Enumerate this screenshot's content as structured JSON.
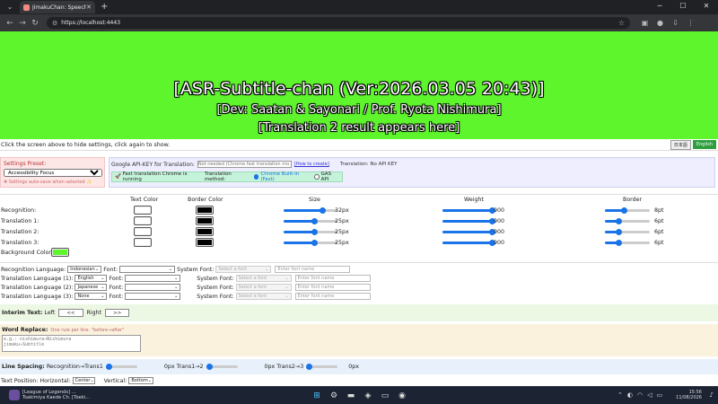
{
  "browser": {
    "tab_title": "JimakuChan: Speech Recog",
    "url": "https://localhost:4443",
    "new_tab": "+",
    "icons": [
      "tune-icon",
      "star-icon",
      "extensions-icon",
      "profile-icon",
      "menu-icon"
    ]
  },
  "subtitle": {
    "line1": "[ASR-Subtitle-chan (Ver:2026.03.05 20:43)]",
    "line2": "[Dev: Saatan & Sayonari / Prof. Ryota Nishimura]",
    "line3": "[Translation 2 result appears here]",
    "background_color": "#5ef52c"
  },
  "hint": "Click the screen above to hide settings, click again to show.",
  "lang_buttons": [
    "日本語",
    "English"
  ],
  "preset": {
    "title": "Settings Preset:",
    "selected": "Accessibility Focus",
    "note": "Settings auto-save when selected"
  },
  "api": {
    "label": "Google API-KEY for Translation:",
    "placeholder": "Not needed (Chrome fast translation mo",
    "howto": "[How to create]",
    "status": "Translation: No API KEY",
    "fast_msg": "Fast translation Chrome is running",
    "method_label": "Translation method:",
    "method_chrome": "Chrome Built-in (Fast)",
    "method_gas": "GAS API"
  },
  "styles": {
    "headers": {
      "text_color": "Text Color",
      "border_color": "Border Color",
      "size": "Size",
      "weight": "Weight",
      "border": "Border"
    },
    "rows": [
      {
        "name": "Recognition:",
        "text_color": "#ffffff",
        "border_color": "#000000",
        "size": "32px",
        "size_frac": 0.72,
        "weight": "900",
        "weight_frac": 1.0,
        "border": "8pt",
        "border_frac": 0.42
      },
      {
        "name": "Translation 1:",
        "text_color": "#ffffff",
        "border_color": "#000000",
        "size": "25px",
        "size_frac": 0.56,
        "weight": "900",
        "weight_frac": 1.0,
        "border": "6pt",
        "border_frac": 0.3
      },
      {
        "name": "Translation 2:",
        "text_color": "#ffffff",
        "border_color": "#000000",
        "size": "25px",
        "size_frac": 0.56,
        "weight": "900",
        "weight_frac": 1.0,
        "border": "6pt",
        "border_frac": 0.3
      },
      {
        "name": "Translation 3:",
        "text_color": "#ffffff",
        "border_color": "#000000",
        "size": "25px",
        "size_frac": 0.56,
        "weight": "900",
        "weight_frac": 1.0,
        "border": "6pt",
        "border_frac": 0.3
      }
    ],
    "bg_label": "Background Color:",
    "bg_color": "#5ef52c"
  },
  "fonts": {
    "font_label": "Font:",
    "system_font_label": "System Font:",
    "system_placeholder": "Select a font",
    "font_name_placeholder": "Enter font name",
    "rows": [
      {
        "label": "Recognition Language:",
        "lang": "Indonesian"
      },
      {
        "label": "Translation Language (1):",
        "lang": "English"
      },
      {
        "label": "Translation Language (2):",
        "lang": "Japanese"
      },
      {
        "label": "Translation Language (3):",
        "lang": "None"
      }
    ]
  },
  "interim": {
    "title": "Interim Text:",
    "left": "Left",
    "left_btn": "<<",
    "right": "Right",
    "right_btn": ">>"
  },
  "word_replace": {
    "title": "Word Replace:",
    "sub": "One rule per line: \"before→after\"",
    "placeholder": "e.g.: nishimura→Nishimura\njimaku→Subtitle"
  },
  "spacing": {
    "title": "Line Spacing:",
    "rec_trans1": "Recognition→Trans1",
    "v1": "0px",
    "t1_t2": "Trans1→2",
    "v2": "0px",
    "t2_t3": "Trans2→3",
    "v3": "0px"
  },
  "text_position": {
    "label": "Text Position: Horizontal:",
    "horizontal": "Center",
    "vertical_label": "Vertical:",
    "vertical": "Bottom"
  },
  "taskbar": {
    "app_line1": "[League of Legends] ...",
    "app_line2": "Tsakimiya Kaede Ch. [Toeki...",
    "time": "15:56",
    "date": "11/08/2026"
  }
}
